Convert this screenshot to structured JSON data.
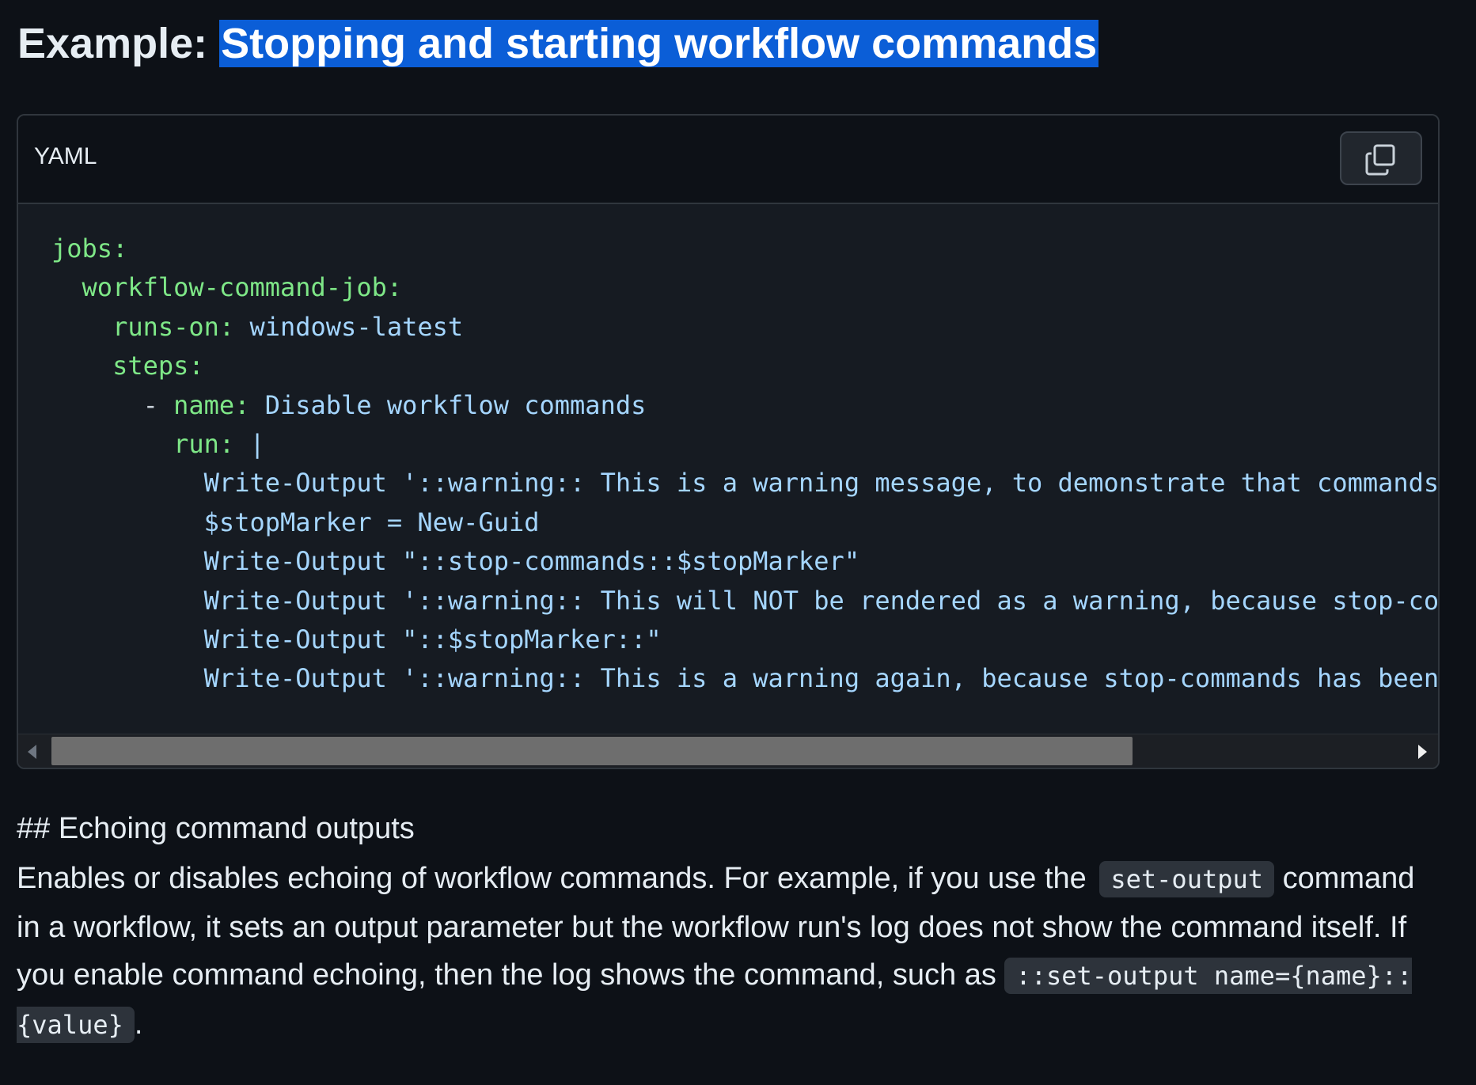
{
  "heading": {
    "prefix": "Example: ",
    "selected_text": "Stopping and starting workflow commands"
  },
  "code_block": {
    "language": "YAML",
    "copy_icon": "copy-icon",
    "lines": [
      {
        "indent": "",
        "key": "jobs:",
        "value": ""
      },
      {
        "indent": "  ",
        "key": "workflow-command-job:",
        "value": ""
      },
      {
        "indent": "    ",
        "key": "runs-on:",
        "value": " windows-latest"
      },
      {
        "indent": "    ",
        "key": "steps:",
        "value": ""
      },
      {
        "indent": "      - ",
        "key": "name:",
        "value": " Disable workflow commands"
      },
      {
        "indent": "        ",
        "key": "run:",
        "value": " |"
      },
      {
        "indent": "          ",
        "key": "",
        "value": "Write-Output '::warning:: This is a warning message, to demonstrate that commands ar"
      },
      {
        "indent": "          ",
        "key": "",
        "value": "$stopMarker = New-Guid"
      },
      {
        "indent": "          ",
        "key": "",
        "value": "Write-Output \"::stop-commands::$stopMarker\""
      },
      {
        "indent": "          ",
        "key": "",
        "value": "Write-Output '::warning:: This will NOT be rendered as a warning, because stop-comma"
      },
      {
        "indent": "          ",
        "key": "",
        "value": "Write-Output \"::$stopMarker::\""
      },
      {
        "indent": "          ",
        "key": "",
        "value": "Write-Output '::warning:: This is a warning again, because stop-commands has been tu"
      }
    ],
    "horizontal_scroll": 0.0
  },
  "section": {
    "title": "## Echoing command outputs"
  },
  "paragraph": {
    "text1": "Enables or disables echoing of workflow commands. For example, if you use the",
    "code1": "set-output",
    "text2": "command in a workflow, it sets an output parameter but the workflow run's log does not show the command itself. If you enable command echoing, then the log shows the command, such as",
    "code2a": "::set-",
    "code2b": "output name={name}::{value}",
    "text3": "."
  },
  "colors": {
    "background": "#0d1117",
    "code_background": "#161b22",
    "yaml_key": "#7ee787",
    "yaml_value": "#a5d6ff",
    "selection": "#0b5ed7"
  }
}
